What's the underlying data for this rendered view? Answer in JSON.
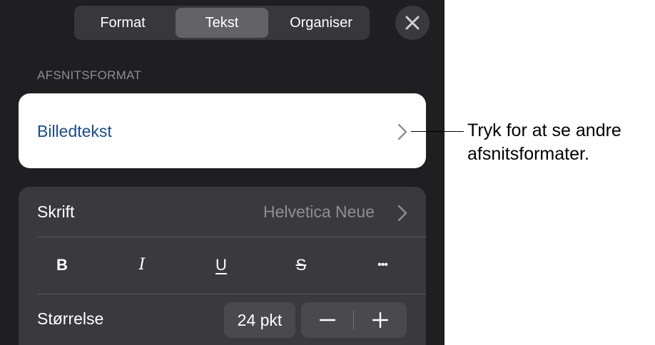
{
  "tabs": [
    {
      "label": "Format",
      "active": false
    },
    {
      "label": "Tekst",
      "active": true
    },
    {
      "label": "Organiser",
      "active": false
    }
  ],
  "close_icon": "close-icon",
  "section_label": "AFSNITSFORMAT",
  "paragraph_style": {
    "name": "Billedtekst",
    "icon": "chevron-right-icon",
    "color": "#1a4a96"
  },
  "font": {
    "label": "Skrift",
    "value": "Helvetica Neue"
  },
  "format_buttons": {
    "bold": "B",
    "italic": "I",
    "underline": "U",
    "strikethrough": "S",
    "more": "•••"
  },
  "size": {
    "label": "Størrelse",
    "value": "24 pkt",
    "decrease_icon": "minus-icon",
    "increase_icon": "plus-icon"
  },
  "callout": {
    "line1": "Tryk for at se andre",
    "line2": "afsnitsformater."
  },
  "colors": {
    "panel_bg": "#1f1f21",
    "group_bg": "#3a3a3d",
    "active_tab": "#636366",
    "accent_text": "#1a4a96"
  }
}
